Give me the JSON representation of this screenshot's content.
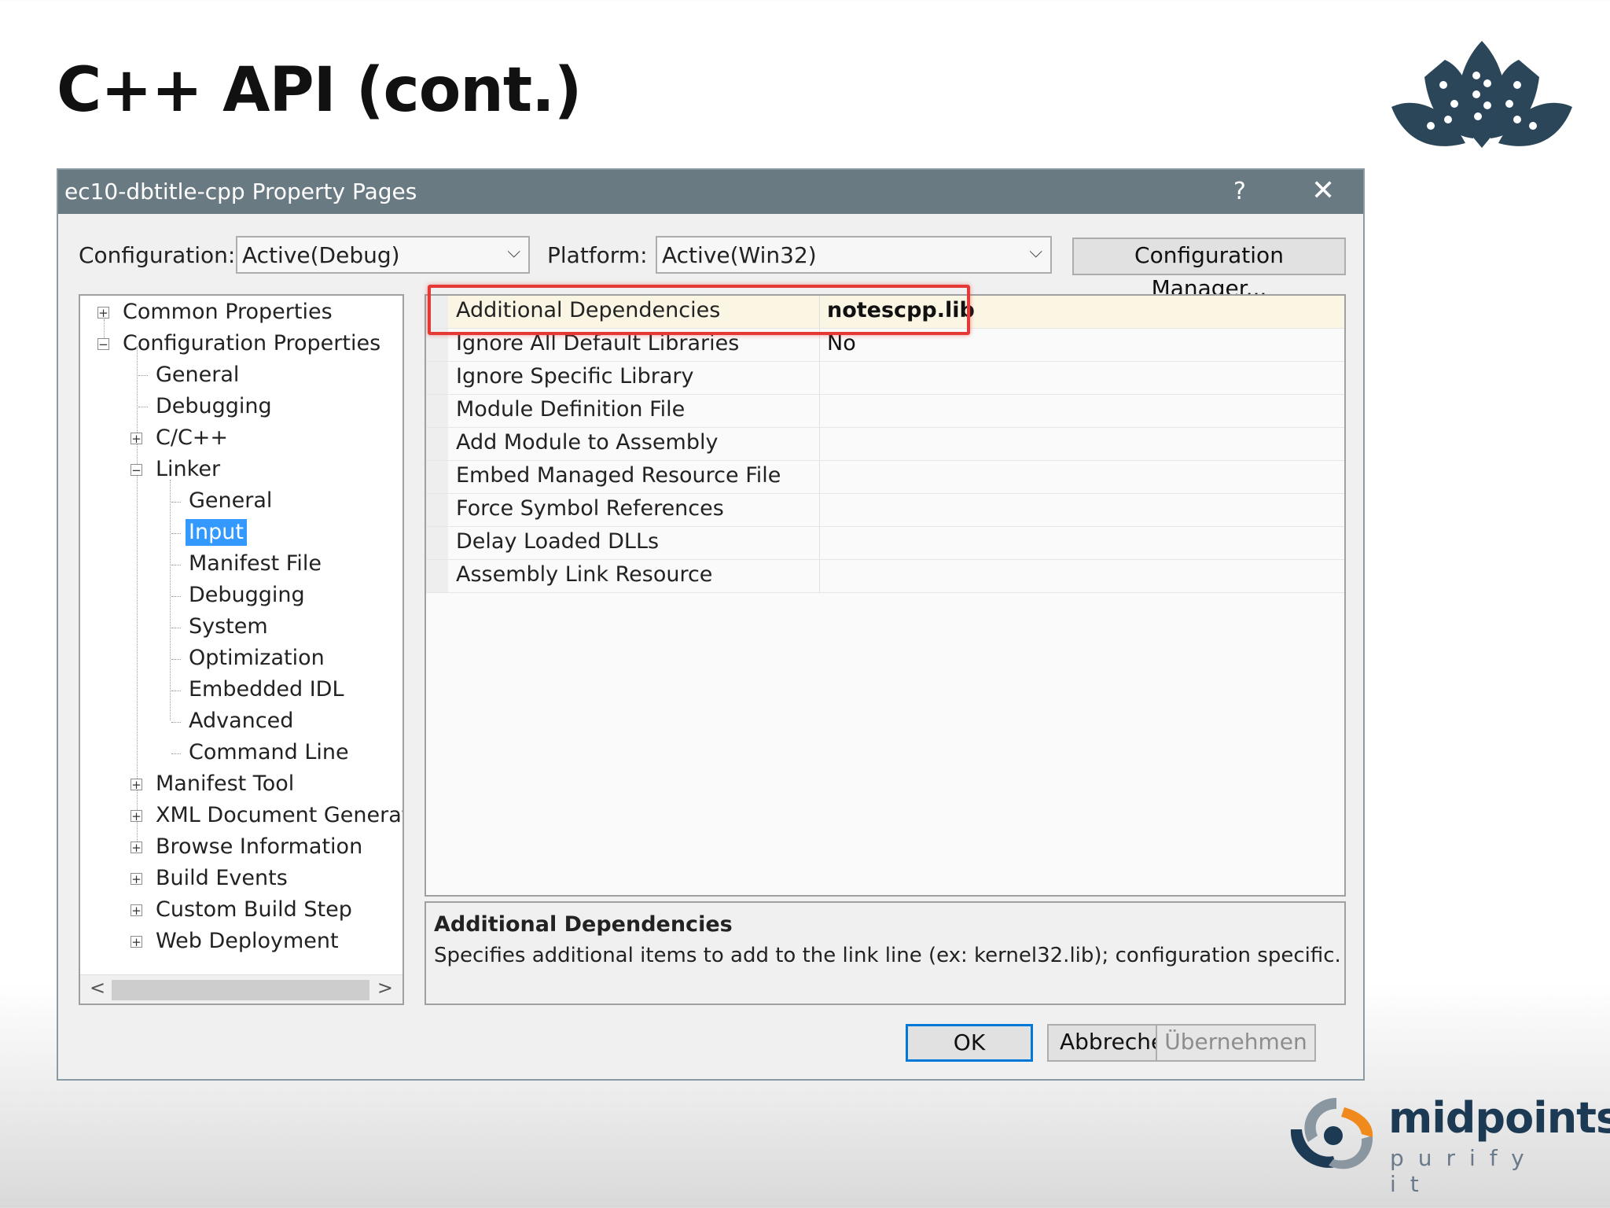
{
  "slide": {
    "title": "C++ API (cont.)"
  },
  "dialog": {
    "title": "ec10-dbtitle-cpp Property Pages",
    "help_label": "?",
    "close_label": "✕",
    "configuration_label": "Configuration:",
    "configuration_value": "Active(Debug)",
    "platform_label": "Platform:",
    "platform_value": "Active(Win32)",
    "config_manager_label": "Configuration Manager...",
    "tree": [
      "Common Properties",
      "Configuration Properties",
      "General",
      "Debugging",
      "C/C++",
      "Linker",
      "General",
      "Input",
      "Manifest File",
      "Debugging",
      "System",
      "Optimization",
      "Embedded IDL",
      "Advanced",
      "Command Line",
      "Manifest Tool",
      "XML Document Generator",
      "Browse Information",
      "Build Events",
      "Custom Build Step",
      "Web Deployment"
    ],
    "tree_expanders": {
      "collapsed": "+",
      "expanded": "−"
    },
    "scroll_left": "<",
    "scroll_right": ">",
    "properties": [
      {
        "name": "Additional Dependencies",
        "value": "notescpp.lib"
      },
      {
        "name": "Ignore All Default Libraries",
        "value": "No"
      },
      {
        "name": "Ignore Specific Library",
        "value": ""
      },
      {
        "name": "Module Definition File",
        "value": ""
      },
      {
        "name": "Add Module to Assembly",
        "value": ""
      },
      {
        "name": "Embed Managed Resource File",
        "value": ""
      },
      {
        "name": "Force Symbol References",
        "value": ""
      },
      {
        "name": "Delay Loaded DLLs",
        "value": ""
      },
      {
        "name": "Assembly Link Resource",
        "value": ""
      }
    ],
    "description": {
      "heading": "Additional Dependencies",
      "text": "Specifies additional items to add to the link line (ex: kernel32.lib); configuration specific."
    },
    "buttons": {
      "ok": "OK",
      "cancel": "Abbrechen",
      "apply": "Übernehmen"
    }
  },
  "brand": {
    "name": "midpoints",
    "tagline": "purify it"
  },
  "colors": {
    "highlight": "#e53935",
    "selection": "#3399ff",
    "titlebar": "#6a7a83",
    "logo": "#2b4559"
  }
}
